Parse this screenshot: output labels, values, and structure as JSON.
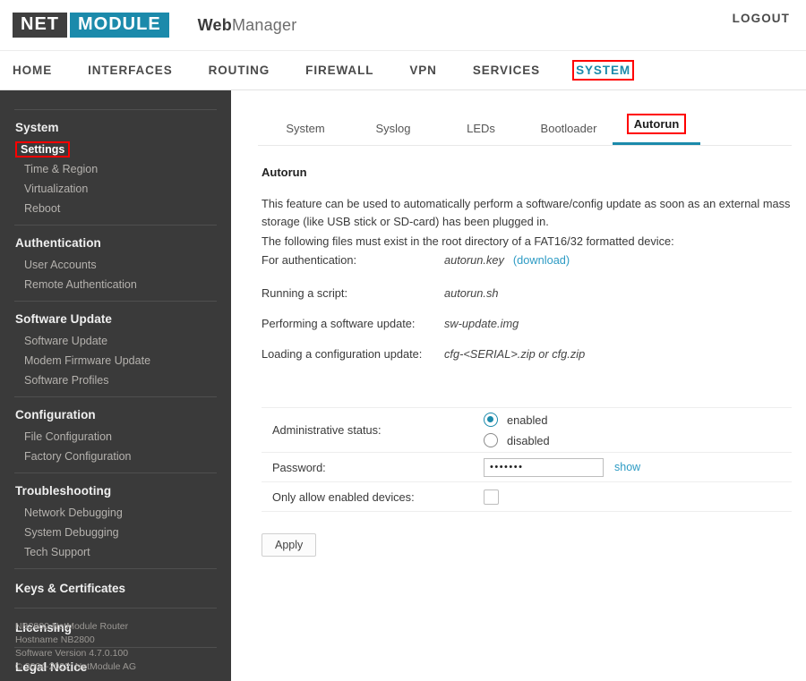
{
  "header": {
    "logo_left": "NET",
    "logo_right": "MODULE",
    "app_title_bold": "Web",
    "app_title_light": "Manager",
    "logout_label": "LOGOUT"
  },
  "mainnav": {
    "items": [
      {
        "label": "HOME",
        "active": false
      },
      {
        "label": "INTERFACES",
        "active": false
      },
      {
        "label": "ROUTING",
        "active": false
      },
      {
        "label": "FIREWALL",
        "active": false
      },
      {
        "label": "VPN",
        "active": false
      },
      {
        "label": "SERVICES",
        "active": false
      },
      {
        "label": "SYSTEM",
        "active": true
      }
    ],
    "active_label": "SYSTEM"
  },
  "sidebar": {
    "groups": [
      {
        "head": "System",
        "items": [
          "Settings",
          "Time & Region",
          "Virtualization",
          "Reboot"
        ],
        "active_item": "Settings"
      },
      {
        "head": "Authentication",
        "items": [
          "User Accounts",
          "Remote Authentication"
        ]
      },
      {
        "head": "Software Update",
        "items": [
          "Software Update",
          "Modem Firmware Update",
          "Software Profiles"
        ]
      },
      {
        "head": "Configuration",
        "items": [
          "File Configuration",
          "Factory Configuration"
        ]
      },
      {
        "head": "Troubleshooting",
        "items": [
          "Network Debugging",
          "System Debugging",
          "Tech Support"
        ]
      }
    ],
    "links": [
      "Keys & Certificates",
      "Licensing",
      "Legal Notice"
    ],
    "footer": {
      "device": "NB2800 NetModule Router",
      "hostname": "Hostname NB2800",
      "version": "Software Version 4.7.0.100",
      "copyright": "© 2004-2022, NetModule AG"
    }
  },
  "tabs": {
    "items": [
      {
        "label": "System",
        "active": false
      },
      {
        "label": "Syslog",
        "active": false
      },
      {
        "label": "LEDs",
        "active": false
      },
      {
        "label": "Bootloader",
        "active": false
      },
      {
        "label": "Autorun",
        "active": true
      }
    ],
    "active_label": "Autorun"
  },
  "panel": {
    "title": "Autorun",
    "desc_line1": "This feature can be used to automatically perform a software/config update as soon as an external mass storage (like USB stick or SD-card) has been plugged in.",
    "desc_line2": "The following files must exist in the root directory of a FAT16/32 formatted device:",
    "auth_label": "For authentication:",
    "auth_file": "autorun.key",
    "auth_download": "(download)",
    "files": [
      {
        "label": "Running a script:",
        "value": "autorun.sh"
      },
      {
        "label": "Performing a software update:",
        "value": "sw-update.img"
      },
      {
        "label": "Loading a configuration update:",
        "value": "cfg-<SERIAL>.zip or cfg.zip"
      }
    ]
  },
  "form": {
    "admin_status_label": "Administrative status:",
    "admin_status_options": [
      "enabled",
      "disabled"
    ],
    "admin_status_value": "enabled",
    "password_label": "Password:",
    "password_value": "•••••••",
    "password_show_link": "show",
    "only_enabled_label": "Only allow enabled devices:",
    "only_enabled_checked": false,
    "apply_label": "Apply"
  },
  "colors": {
    "accent": "#1b8aab",
    "link": "#2d9bc4",
    "sidebar_bg": "#3a3a3a",
    "annotation": "#ff0000"
  }
}
